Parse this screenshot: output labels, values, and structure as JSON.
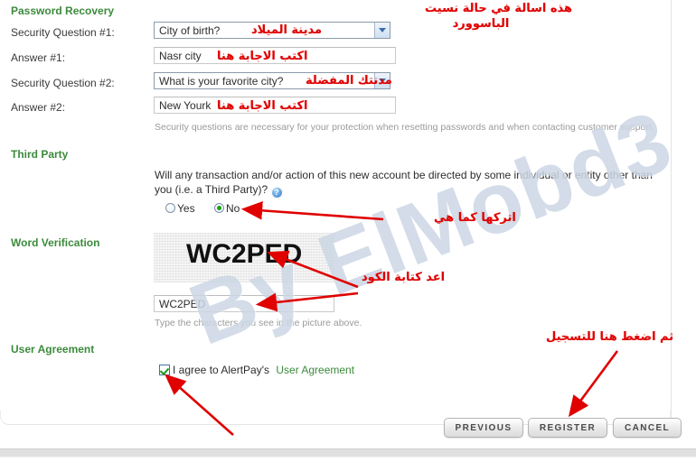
{
  "form": {
    "sections": {
      "password_recovery": "Password Recovery",
      "third_party": "Third Party",
      "word_verification": "Word Verification",
      "user_agreement": "User Agreement"
    },
    "labels": {
      "security_question_1": "Security Question #1:",
      "answer_1": "Answer #1:",
      "security_question_2": "Security Question #2:",
      "answer_2": "Answer #2:"
    },
    "values": {
      "security_question_1": "City of birth?",
      "answer_1": "Nasr city",
      "security_question_2": "What is your favorite city?",
      "answer_2": "New Yourk",
      "captcha_input": "WC2PED"
    },
    "notes": {
      "security_note": "Security questions are necessary for your protection when resetting passwords and when contacting customer support.",
      "captcha_note": "Type the characters you see in the picture above."
    },
    "third_party": {
      "question": "Will any transaction and/or action of this new account be directed by some individual or entity other than you (i.e. a Third Party)?",
      "help_icon_glyph": "?",
      "option_yes": "Yes",
      "option_no": "No",
      "selected": "No"
    },
    "captcha": {
      "code": "WC2PED"
    },
    "agreement": {
      "checked": true,
      "text_before": "I agree to AlertPay's",
      "link_text": "User Agreement"
    },
    "buttons": {
      "previous": "PREVIOUS",
      "register": "REGISTER",
      "cancel": "CANCEL"
    }
  },
  "annotations": {
    "top_right_line1": "هذه اسالة في حالة نسيت",
    "top_right_line2": "الباسوورد",
    "question1": "مدينة الميلاد",
    "answer1": "اكتب الاجابة هنا",
    "question2": "مدنتك المفضلة",
    "answer2": "اكتب الاجابة هنا",
    "third_party": "اتركها كما هي",
    "captcha": "اعد كتابة الكود",
    "register": "ثم اضغط هنا للتسجيل"
  },
  "watermark": {
    "text": "By ElMobd3"
  },
  "colors": {
    "section_heading": "#3c8a3c",
    "annotation_red": "#e00000",
    "link_green": "#3c8a3c",
    "watermark": "#ccd7e4"
  }
}
